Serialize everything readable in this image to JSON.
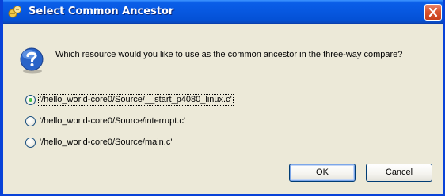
{
  "dialog": {
    "title": "Select Common Ancestor",
    "message": "Which resource would you like to use as the common ancestor in the three-way compare?"
  },
  "options": [
    {
      "label": "'/hello_world-core0/Source/__start_p4080_linux.c'",
      "selected": true,
      "focused": true
    },
    {
      "label": "'/hello_world-core0/Source/interrupt.c'",
      "selected": false,
      "focused": false
    },
    {
      "label": "'/hello_world-core0/Source/main.c'",
      "selected": false,
      "focused": false
    }
  ],
  "buttons": {
    "ok_label": "OK",
    "cancel_label": "Cancel"
  },
  "icons": {
    "title": "eclipse-compare-icon",
    "close": "close-icon",
    "message": "question-icon"
  },
  "colors": {
    "titlebar": "#0758e0",
    "window_frame": "#0842d8",
    "dialog_bg": "#ece9d8",
    "close_button": "#d9552f",
    "radio_selected": "#21a121"
  }
}
